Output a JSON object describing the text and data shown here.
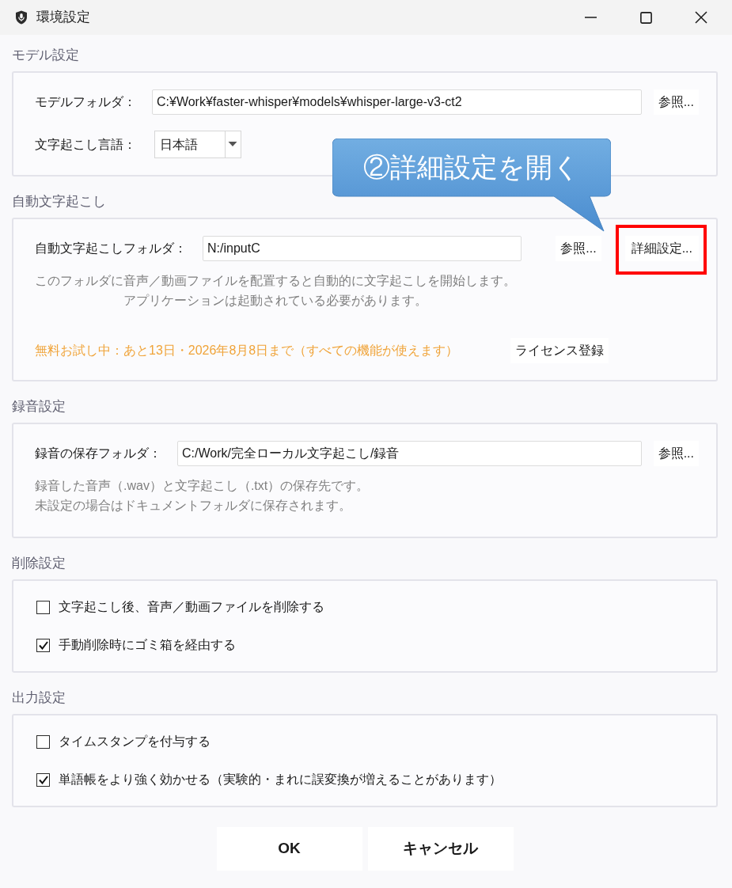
{
  "window": {
    "title": "環境設定"
  },
  "sections": [
    {
      "title": "モデル設定",
      "items": [
        {
          "kind": "path",
          "label": "モデルフォルダ：",
          "value": "C:¥Work¥faster-whisper¥models¥whisper-large-v3-ct2",
          "buttons": [
            {
              "label": "参照...",
              "highlighted": false
            }
          ]
        },
        {
          "kind": "select",
          "label": "文字起こし言語：",
          "value": "日本語"
        }
      ]
    },
    {
      "title": "自動文字起こし",
      "items": [
        {
          "kind": "path",
          "label": "自動文字起こしフォルダ：",
          "value": "N:/inputC",
          "buttons": [
            {
              "label": "参照...",
              "highlighted": false
            },
            {
              "label": "詳細設定...",
              "highlighted": true
            }
          ]
        },
        {
          "kind": "centered_note",
          "lines": [
            "このフォルダに音声／動画ファイルを配置すると自動的に文字起こしを開始します。",
            "アプリケーションは起動されている必要があります。"
          ]
        },
        {
          "kind": "trial",
          "text": "無料お試し中：あと13日・2026年8月8日まで（すべての機能が使えます）",
          "button": "ライセンス登録"
        }
      ]
    },
    {
      "title": "録音設定",
      "items": [
        {
          "kind": "path",
          "label": "録音の保存フォルダ：",
          "value": "C:/Work/完全ローカル文字起こし/録音",
          "buttons": [
            {
              "label": "参照...",
              "highlighted": false
            }
          ]
        },
        {
          "kind": "note",
          "lines": [
            "録音した音声（.wav）と文字起こし（.txt）の保存先です。",
            "未設定の場合はドキュメントフォルダに保存されます。"
          ]
        }
      ]
    },
    {
      "title": "削除設定",
      "items": [
        {
          "kind": "checkbox",
          "label": "文字起こし後、音声／動画ファイルを削除する",
          "checked": false
        },
        {
          "kind": "checkbox",
          "label": "手動削除時にゴミ箱を経由する",
          "checked": true
        }
      ]
    },
    {
      "title": "出力設定",
      "items": [
        {
          "kind": "checkbox",
          "label": "タイムスタンプを付与する",
          "checked": false
        },
        {
          "kind": "checkbox",
          "label": "単語帳をより強く効かせる（実験的・まれに誤変換が増えることがあります）",
          "checked": true
        }
      ]
    }
  ],
  "footer": {
    "buttons": [
      "OK",
      "キャンセル"
    ]
  },
  "callout": {
    "text": "②詳細設定を開く"
  }
}
